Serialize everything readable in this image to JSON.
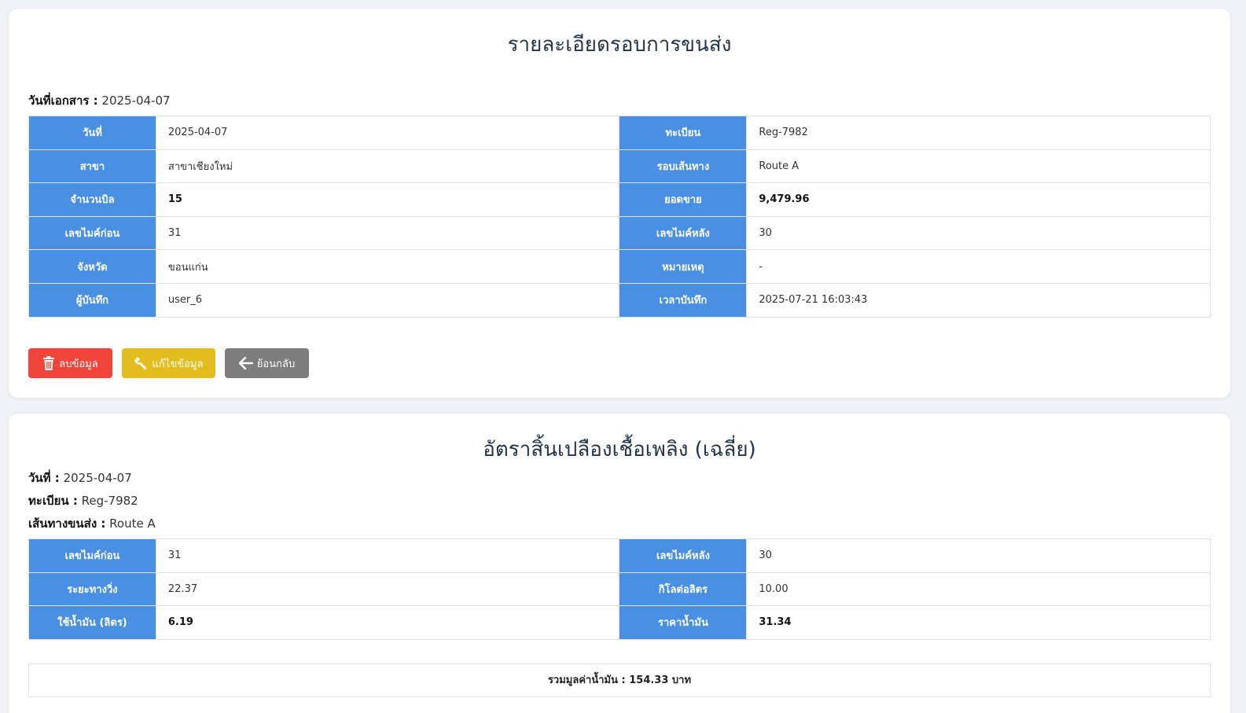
{
  "detail": {
    "title": "รายละเอียดรอบการขนส่ง",
    "doc_date_label": "วันที่เอกสาร :",
    "doc_date_value": "2025-04-07",
    "rows": [
      {
        "l1": "วันที่",
        "v1": "2025-04-07",
        "l2": "ทะเบียน",
        "v2": "Reg-7982"
      },
      {
        "l1": "สาขา",
        "v1": "สาขาเชียงใหม่",
        "l2": "รอบเส้นทาง",
        "v2": "Route A"
      },
      {
        "l1": "จำนวนบิล",
        "v1": "15",
        "l2": "ยอดขาย",
        "v2": "9,479.96"
      },
      {
        "l1": "เลขไมค์ก่อน",
        "v1": "31",
        "l2": "เลขไมค์หลัง",
        "v2": "30"
      },
      {
        "l1": "จังหวัด",
        "v1": "ขอนแก่น",
        "l2": "หมายเหตุ",
        "v2": "-"
      },
      {
        "l1": "ผู้บันทึก",
        "v1": "user_6",
        "l2": "เวลาบันทึก",
        "v2": "2025-07-21 16:03:43"
      }
    ],
    "buttons": {
      "delete": "ลบข้อมูล",
      "edit": "แก้ไขข้อมูล",
      "back": "ย้อนกลับ"
    }
  },
  "fuel": {
    "title": "อัตราสิ้นเปลืองเชื้อเพลิง (เฉลี่ย)",
    "date_label": "วันที่ :",
    "date_value": "2025-04-07",
    "reg_label": "ทะเบียน :",
    "reg_value": "Reg-7982",
    "route_label": "เส้นทางขนส่ง :",
    "route_value": "Route A",
    "rows": [
      {
        "l1": "เลขไมค์ก่อน",
        "v1": "31",
        "l2": "เลขไมค์หลัง",
        "v2": "30"
      },
      {
        "l1": "ระยะทางวิ่ง",
        "v1": "22.37",
        "l2": "กิโลต่อลิตร",
        "v2": "10.00"
      },
      {
        "l1": "ใช้น้ำมัน (ลิตร)",
        "v1": "6.19",
        "l2": "ราคาน้ำมัน",
        "v2": "31.34"
      }
    ],
    "total_text": "รวมมูลค่าน้ำมัน : 154.33 บาท"
  },
  "colors": {
    "label_bg": "#4a90e2",
    "delete": "#f1443a",
    "edit": "#e3bd1e",
    "back": "#7d7d7d"
  },
  "icons": {
    "delete": "trash-icon",
    "edit": "wrench-icon",
    "back": "arrow-left-icon"
  }
}
